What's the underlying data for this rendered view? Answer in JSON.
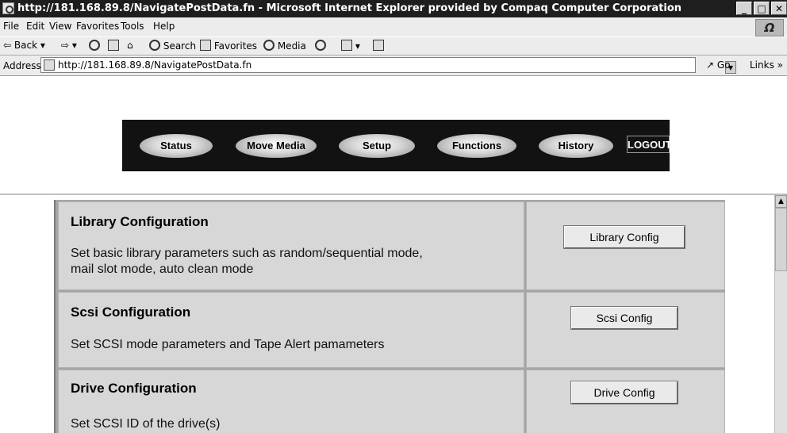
{
  "window": {
    "title": "http://181.168.89.8/NavigatePostData.fn - Microsoft Internet Explorer provided by Compaq Computer Corporation",
    "controls": {
      "minimize": "_",
      "maximize": "□",
      "close": "✕"
    }
  },
  "menu": [
    "File",
    "Edit",
    "View",
    "Favorites",
    "Tools",
    "Help"
  ],
  "toolbar": {
    "back": "Back",
    "search": "Search",
    "favorites": "Favorites",
    "media": "Media"
  },
  "address": {
    "label": "Address",
    "url": "http://181.168.89.8/NavigatePostData.fn",
    "go": "Go",
    "links": "Links"
  },
  "nav": [
    "Status",
    "Move Media",
    "Setup",
    "Functions",
    "History"
  ],
  "logout_label": "LOGOUT",
  "rows": [
    {
      "title": "Library Configuration",
      "desc1": "Set basic library parameters such as random/sequential mode,",
      "desc2": "mail slot mode, auto clean mode",
      "button": "Library Config"
    },
    {
      "title": "Scsi Configuration",
      "desc1": "Set SCSI mode parameters and Tape Alert pamameters",
      "button": "Scsi Config"
    },
    {
      "title": "Drive Configuration",
      "desc1": "Set SCSI ID of the drive(s)",
      "button": "Drive Config"
    }
  ]
}
